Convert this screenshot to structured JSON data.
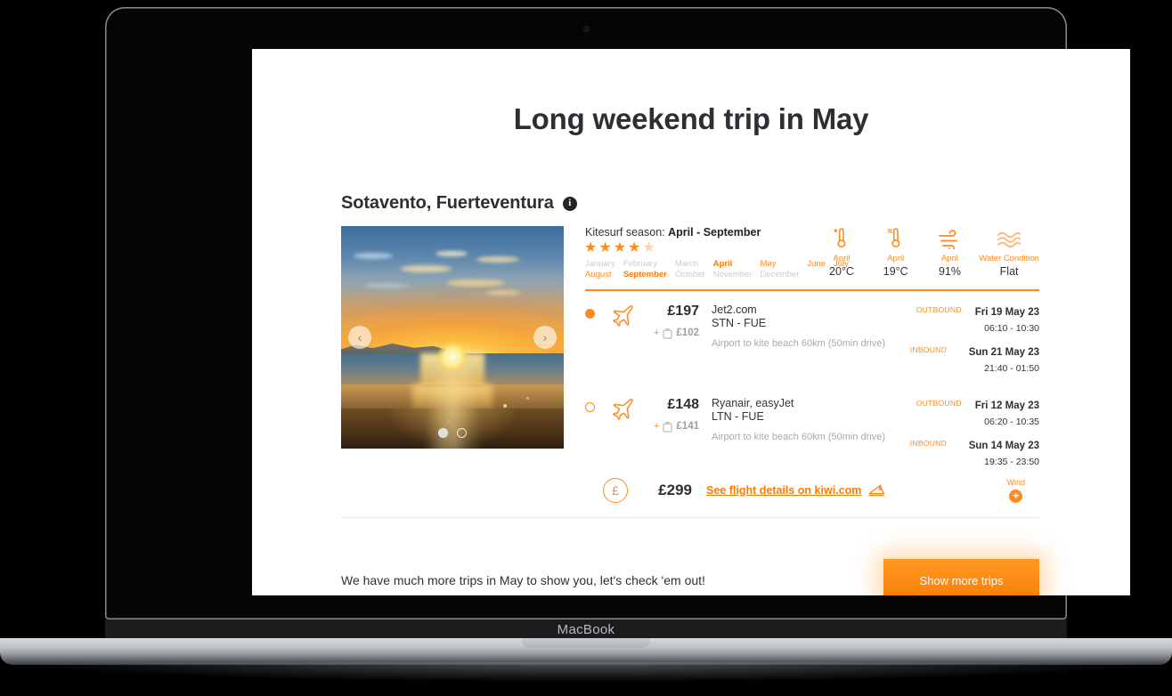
{
  "device": {
    "brand_label": "MacBook"
  },
  "page": {
    "heading": "Long weekend trip in May"
  },
  "spot": {
    "title": "Sotavento, Fuerteventura",
    "info_icon": "info-icon"
  },
  "carousel": {
    "prev_label": "‹",
    "next_label": "›",
    "slide_count": 2,
    "active_slide": 1,
    "image_alt": "Beach sunset over the ocean"
  },
  "season": {
    "label": "Kitesurf season:",
    "range": "April - September",
    "rating_stars": 4.5,
    "months_row1": [
      {
        "name": "January",
        "state": "off"
      },
      {
        "name": "February",
        "state": "off"
      },
      {
        "name": "March",
        "state": "off"
      },
      {
        "name": "April",
        "state": "strong"
      },
      {
        "name": "May",
        "state": "on"
      },
      {
        "name": "June",
        "state": "on"
      },
      {
        "name": "July",
        "state": "on"
      }
    ],
    "months_row2": [
      {
        "name": "August",
        "state": "on"
      },
      {
        "name": "September",
        "state": "strong"
      },
      {
        "name": "October",
        "state": "off"
      },
      {
        "name": "November",
        "state": "off"
      },
      {
        "name": "December",
        "state": "off"
      }
    ]
  },
  "metrics": [
    {
      "icon": "air-temperature-icon",
      "label": "April",
      "value": "20°C"
    },
    {
      "icon": "water-temperature-icon",
      "label": "April",
      "value": "19°C"
    },
    {
      "icon": "wind-icon",
      "label": "April",
      "value": "91%"
    },
    {
      "icon": "water-waves-icon",
      "label": "Water Condition",
      "value": "Flat"
    }
  ],
  "flights": [
    {
      "selected": true,
      "price": "£197",
      "bag_plus": "+",
      "bag_price": "£102",
      "airline": "Jet2.com",
      "route": "STN - FUE",
      "transfer": "Airport to kite beach 60km (50min drive)",
      "outbound_tag": "OUTBOUND",
      "outbound_date": "Fri 19 May 23",
      "outbound_time": "06:10 - 10:30",
      "inbound_tag": "INBOUND",
      "inbound_date": "Sun 21 May 23",
      "inbound_time": "21:40 - 01:50"
    },
    {
      "selected": false,
      "price": "£148",
      "bag_plus": "+",
      "bag_price": "£141",
      "airline": "Ryanair, easyJet",
      "route": "LTN - FUE",
      "transfer": "Airport to kite beach 60km (50min drive)",
      "outbound_tag": "OUTBOUND",
      "outbound_date": "Fri 12 May 23",
      "outbound_time": "06:20 - 10:35",
      "inbound_tag": "INBOUND",
      "inbound_date": "Sun 14 May 23",
      "inbound_time": "19:35 - 23:50"
    }
  ],
  "total": {
    "currency_symbol": "£",
    "amount": "£299",
    "link_text": "See flight details on kiwi.com",
    "ticket_icon": "ticket-icon",
    "wind_label": "Wind",
    "wind_plus": "+"
  },
  "footer": {
    "text": "We have much more trips in May to show you, let's check 'em out!",
    "button_label": "Show more trips"
  },
  "colors": {
    "accent": "#FF8A1E",
    "accent_dark": "#FF7A00",
    "text": "#2d2f33",
    "muted": "#a6aaae"
  }
}
